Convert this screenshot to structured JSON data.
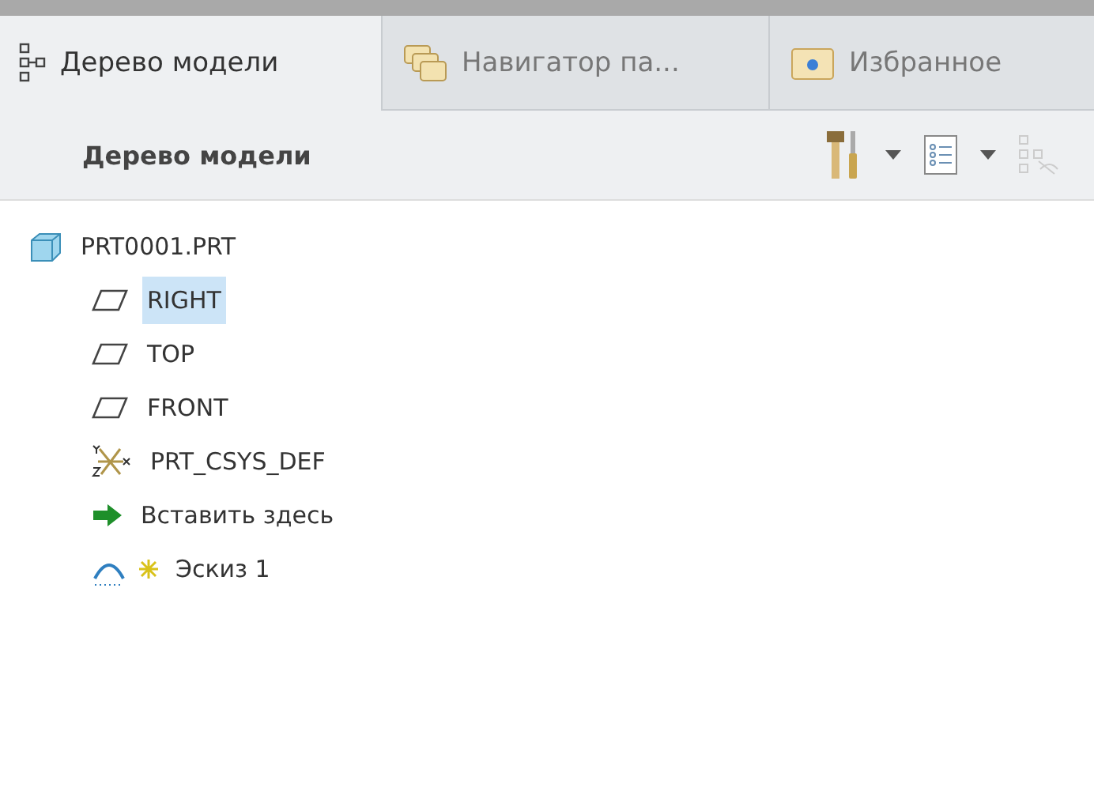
{
  "tabs": [
    {
      "label": "Дерево модели",
      "kind": "tree",
      "selected": true
    },
    {
      "label": "Навигатор па...",
      "kind": "folders",
      "selected": false
    },
    {
      "label": "Избранное",
      "kind": "favorites",
      "selected": false
    }
  ],
  "toolbar": {
    "title": "Дерево модели"
  },
  "tree": {
    "label": "PRT0001.PRT",
    "kind": "part",
    "selected": false,
    "children": [
      {
        "label": "RIGHT",
        "kind": "plane",
        "selected": true
      },
      {
        "label": "TOP",
        "kind": "plane",
        "selected": false
      },
      {
        "label": "FRONT",
        "kind": "plane",
        "selected": false
      },
      {
        "label": "PRT_CSYS_DEF",
        "kind": "csys",
        "selected": false
      },
      {
        "label": "Вставить здесь",
        "kind": "insert",
        "selected": false
      },
      {
        "label": "Эскиз 1",
        "kind": "sketch",
        "selected": false
      }
    ]
  }
}
